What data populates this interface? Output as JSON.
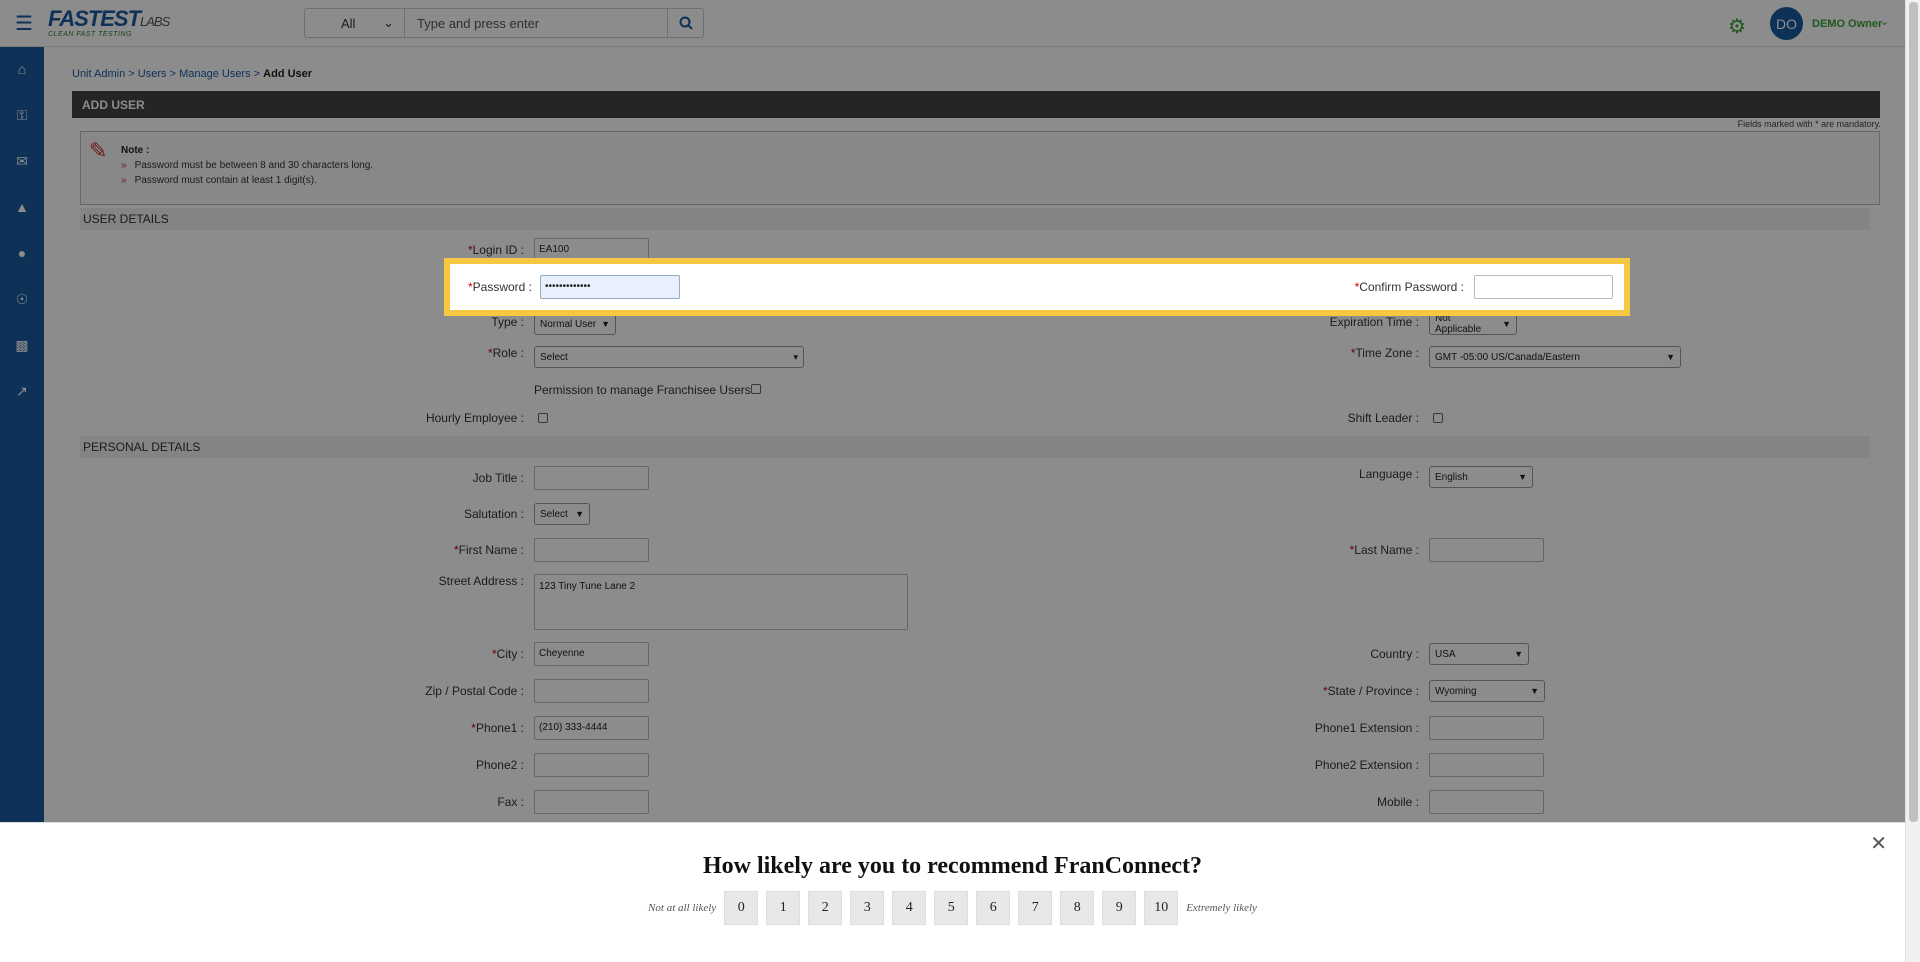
{
  "header": {
    "logo_main": "FASTEST",
    "logo_labs": "LABS",
    "logo_tagline": "CLEAN FAST TESTING",
    "search_scope": "All",
    "search_placeholder": "Type and press enter",
    "avatar_initials": "DO",
    "user_name": "DEMO Owner"
  },
  "breadcrumb": {
    "items": [
      "Unit Admin",
      "Users",
      "Manage Users"
    ],
    "separator": ">",
    "current": "Add User"
  },
  "page_title": "ADD USER",
  "mandatory_note": "Fields marked with * are mandatory.",
  "note": {
    "title": "Note :",
    "lines": [
      "Password must be between 8 and 30 characters long.",
      "Password must contain at least 1 digit(s)."
    ]
  },
  "sections": {
    "user_details": "USER DETAILS",
    "personal_details": "PERSONAL DETAILS"
  },
  "fields": {
    "login_id": {
      "label": "Login ID :",
      "value": "EA100"
    },
    "password": {
      "label": "Password :",
      "value": "•••••••••••••"
    },
    "confirm_password": {
      "label": "Confirm Password :",
      "value": ""
    },
    "type": {
      "label": "Type :",
      "value": "Normal User"
    },
    "expiration_time": {
      "label": "Expiration Time :",
      "value": "Not Applicable"
    },
    "role": {
      "label": "Role :",
      "value": "Select"
    },
    "time_zone": {
      "label": "Time Zone :",
      "value": "GMT -05:00 US/Canada/Eastern"
    },
    "permission_franchisee": {
      "label": "Permission to manage Franchisee Users"
    },
    "hourly_employee": {
      "label": "Hourly Employee :"
    },
    "shift_leader": {
      "label": "Shift Leader :"
    },
    "job_title": {
      "label": "Job Title :",
      "value": ""
    },
    "language": {
      "label": "Language :",
      "value": "English"
    },
    "salutation": {
      "label": "Salutation :",
      "value": "Select"
    },
    "first_name": {
      "label": "First Name :",
      "value": ""
    },
    "last_name": {
      "label": "Last Name :",
      "value": ""
    },
    "street_address": {
      "label": "Street Address :",
      "value": "123 Tiny Tune Lane 2"
    },
    "city": {
      "label": "City :",
      "value": "Cheyenne"
    },
    "country": {
      "label": "Country :",
      "value": "USA"
    },
    "zip": {
      "label": "Zip / Postal Code :",
      "value": ""
    },
    "state": {
      "label": "State / Province :",
      "value": "Wyoming"
    },
    "phone1": {
      "label": "Phone1 :",
      "value": "(210) 333-4444"
    },
    "phone1_ext": {
      "label": "Phone1 Extension :",
      "value": ""
    },
    "phone2": {
      "label": "Phone2 :",
      "value": ""
    },
    "phone2_ext": {
      "label": "Phone2 Extension :",
      "value": ""
    },
    "fax": {
      "label": "Fax :",
      "value": ""
    },
    "mobile": {
      "label": "Mobile :",
      "value": ""
    }
  },
  "required_mark": "*",
  "survey": {
    "question": "How likely are you to recommend FranConnect?",
    "low_label": "Not at all likely",
    "high_label": "Extremely likely",
    "scale": [
      "0",
      "1",
      "2",
      "3",
      "4",
      "5",
      "6",
      "7",
      "8",
      "9",
      "10"
    ]
  },
  "colors": {
    "brand_blue": "#1a5aa0",
    "accent_green": "#3aa03a",
    "highlight_yellow": "#f5c842"
  }
}
